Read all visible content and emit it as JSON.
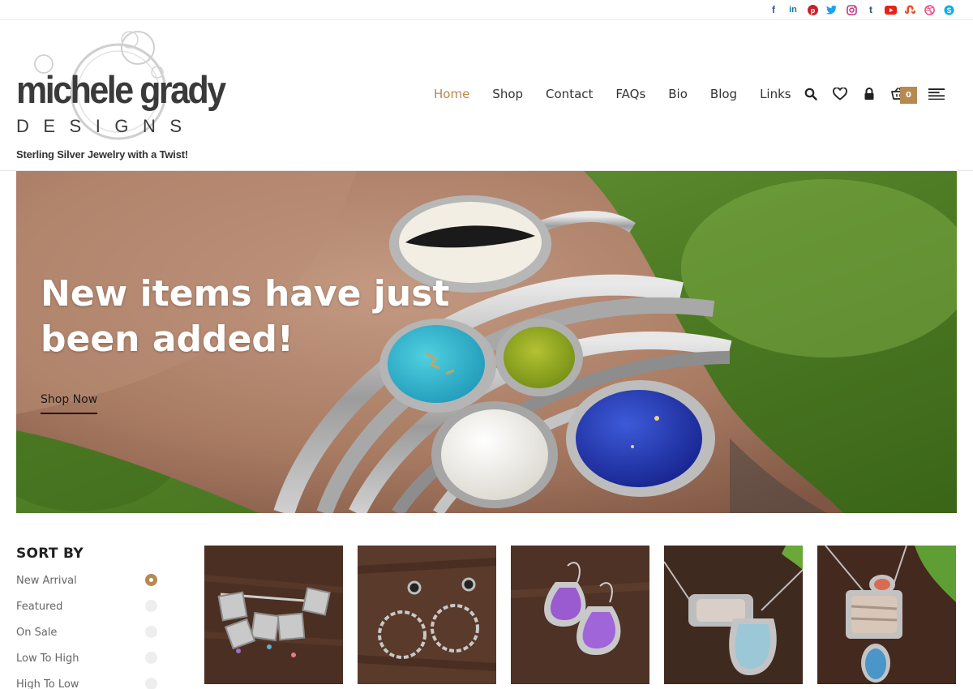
{
  "social": {
    "icons": [
      {
        "name": "facebook-icon",
        "glyph": "f",
        "color": "#3b5998"
      },
      {
        "name": "linkedin-icon",
        "glyph": "in",
        "color": "#0e76a8"
      },
      {
        "name": "pinterest-icon",
        "glyph": "P",
        "color": "#cb2027"
      },
      {
        "name": "twitter-icon",
        "glyph": "t",
        "color": "#1da1f2"
      },
      {
        "name": "instagram-icon",
        "glyph": "◎",
        "color": "#c13584"
      },
      {
        "name": "tumblr-icon",
        "glyph": "t",
        "color": "#34526f"
      },
      {
        "name": "youtube-icon",
        "glyph": "▶",
        "color": "#e62117"
      },
      {
        "name": "stumbleupon-icon",
        "glyph": "su",
        "color": "#eb4924"
      },
      {
        "name": "dribbble-icon",
        "glyph": "◍",
        "color": "#ea4c89"
      },
      {
        "name": "skype-icon",
        "glyph": "S",
        "color": "#00aff0"
      }
    ]
  },
  "logo": {
    "name": "michele grady",
    "designs": "DESIGNS",
    "tagline": "Sterling Silver Jewelry with a Twist!"
  },
  "nav": {
    "items": [
      "Home",
      "Shop",
      "Contact",
      "FAQs",
      "Bio",
      "Blog",
      "Links"
    ],
    "active": "Home",
    "cart_count": "0"
  },
  "hero": {
    "title": "New items have just been added!",
    "button": "Shop Now"
  },
  "sort": {
    "title": "SORT BY",
    "options": [
      "New Arrival",
      "Featured",
      "On Sale",
      "Low To High",
      "High To Low"
    ],
    "selected": 0
  },
  "colors": {
    "accent": "#b5894f",
    "text": "#333333"
  }
}
